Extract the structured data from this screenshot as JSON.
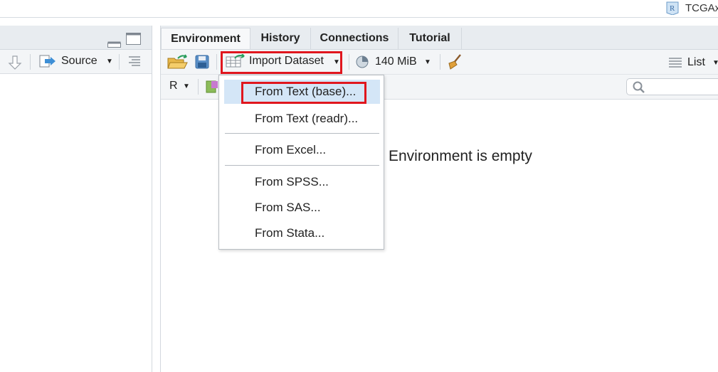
{
  "topbar": {
    "project_name": "TCGAx",
    "project_icon": "r-project-icon"
  },
  "left_pane": {
    "toolbar": {
      "source_label": "Source",
      "icons": [
        "arrow-down-icon",
        "source-icon",
        "chevron-down-icon",
        "align-lines-icon"
      ]
    },
    "header_icons": [
      "minimize-icon",
      "maximize-icon"
    ]
  },
  "right_pane": {
    "tabs": [
      {
        "label": "Environment",
        "active": true
      },
      {
        "label": "History",
        "active": false
      },
      {
        "label": "Connections",
        "active": false
      },
      {
        "label": "Tutorial",
        "active": false
      }
    ],
    "toolbar": {
      "import_dataset_label": "Import Dataset",
      "memory_label": "140 MiB",
      "view_label": "List",
      "language_label": "R"
    },
    "search": {
      "placeholder": ""
    },
    "empty_message": "Environment is empty"
  },
  "import_menu": {
    "items": [
      {
        "label": "From Text (base)...",
        "selected": true
      },
      {
        "label": "From Text (readr)...",
        "selected": false
      },
      {
        "label": "From Excel...",
        "selected": false
      },
      {
        "label": "From SPSS...",
        "selected": false
      },
      {
        "label": "From SAS...",
        "selected": false
      },
      {
        "label": "From Stata...",
        "selected": false
      }
    ]
  },
  "colors": {
    "highlight": "#e0161e",
    "menu_selected": "#d4e6f7",
    "pane_header": "#e8ecf0",
    "toolbar": "#f3f5f7"
  }
}
